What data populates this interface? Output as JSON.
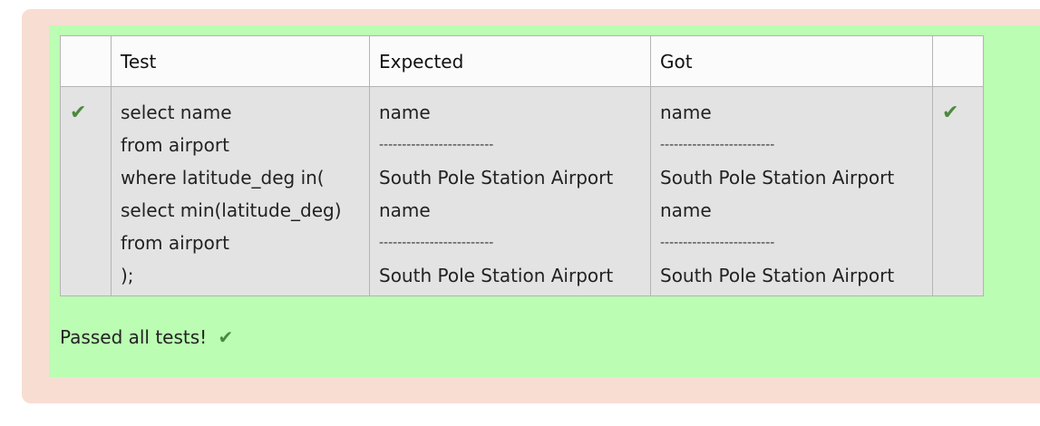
{
  "table": {
    "headers": [
      "",
      "Test",
      "Expected",
      "Got",
      ""
    ],
    "rows": [
      {
        "passed_icon": "check-icon",
        "test_lines": [
          "select name",
          "from airport",
          "where latitude_deg in(",
          "select min(latitude_deg)",
          "from airport",
          ");"
        ],
        "expected_lines": [
          "name",
          "-------------------------",
          "South Pole Station Airport",
          "name",
          "-------------------------",
          "South Pole Station Airport"
        ],
        "got_lines": [
          "name",
          "-------------------------",
          "South Pole Station Airport",
          "name",
          "-------------------------",
          "South Pole Station Airport"
        ],
        "result_icon": "check-icon"
      }
    ]
  },
  "summary": {
    "text": "Passed all tests!",
    "icon": "check-icon"
  },
  "colors": {
    "outer_background": "#f8ddd3",
    "inner_background": "#bbfdb2",
    "check": "#4a8a3d"
  }
}
